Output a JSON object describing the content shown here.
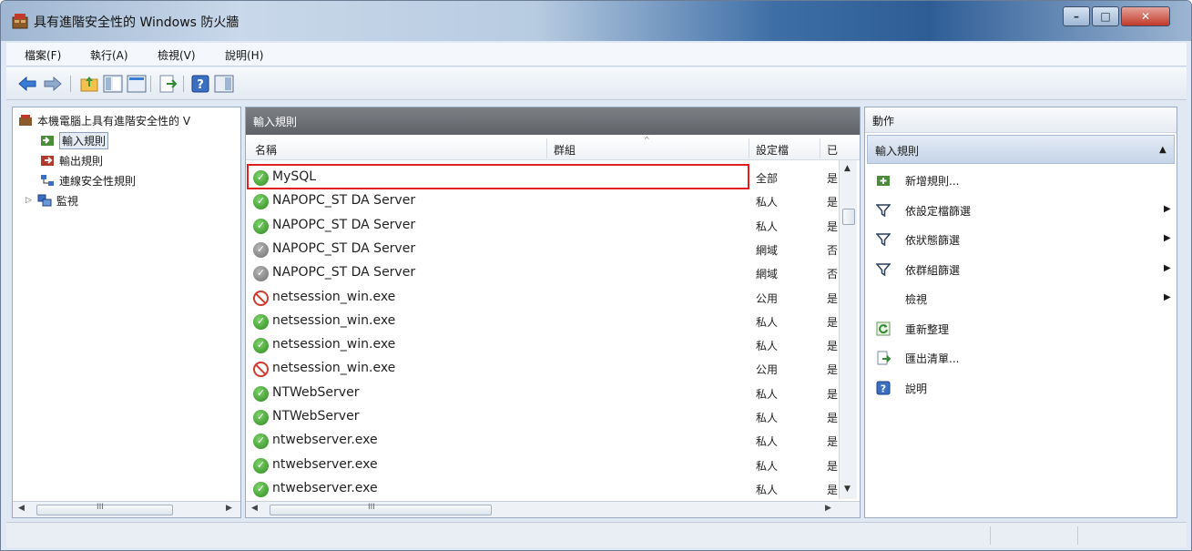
{
  "window": {
    "title": "具有進階安全性的 Windows 防火牆"
  },
  "menu": [
    {
      "label": "檔案(F)"
    },
    {
      "label": "執行(A)"
    },
    {
      "label": "檢視(V)"
    },
    {
      "label": "說明(H)"
    }
  ],
  "toolbar": {
    "icons": [
      "back-icon",
      "forward-icon",
      "up-folder-icon",
      "show-hide-tree-icon",
      "export-icon",
      "help-icon",
      "show-action-pane-icon"
    ]
  },
  "tree": {
    "root": "本機電腦上具有進階安全性的 V",
    "items": [
      {
        "label": "輸入規則",
        "selected": true
      },
      {
        "label": "輸出規則"
      },
      {
        "label": "連線安全性規則"
      },
      {
        "label": "監視"
      }
    ]
  },
  "center": {
    "header": "輸入規則",
    "columns": {
      "name": "名稱",
      "group": "群組",
      "profile": "設定檔",
      "enabled": "已"
    },
    "rules": [
      {
        "name": "MySQL",
        "state": "ok",
        "profile": "全部",
        "enabled": "是"
      },
      {
        "name": "NAPOPC_ST DA Server",
        "state": "ok",
        "profile": "私人",
        "enabled": "是"
      },
      {
        "name": "NAPOPC_ST DA Server",
        "state": "ok",
        "profile": "私人",
        "enabled": "是"
      },
      {
        "name": "NAPOPC_ST DA Server",
        "state": "off",
        "profile": "網域",
        "enabled": "否"
      },
      {
        "name": "NAPOPC_ST DA Server",
        "state": "off",
        "profile": "網域",
        "enabled": "否"
      },
      {
        "name": "netsession_win.exe",
        "state": "block",
        "profile": "公用",
        "enabled": "是"
      },
      {
        "name": "netsession_win.exe",
        "state": "ok",
        "profile": "私人",
        "enabled": "是"
      },
      {
        "name": "netsession_win.exe",
        "state": "ok",
        "profile": "私人",
        "enabled": "是"
      },
      {
        "name": "netsession_win.exe",
        "state": "block",
        "profile": "公用",
        "enabled": "是"
      },
      {
        "name": "NTWebServer",
        "state": "ok",
        "profile": "私人",
        "enabled": "是"
      },
      {
        "name": "NTWebServer",
        "state": "ok",
        "profile": "私人",
        "enabled": "是"
      },
      {
        "name": "ntwebserver.exe",
        "state": "ok",
        "profile": "私人",
        "enabled": "是"
      },
      {
        "name": "ntwebserver.exe",
        "state": "ok",
        "profile": "私人",
        "enabled": "是"
      },
      {
        "name": "ntwebserver.exe",
        "state": "ok",
        "profile": "私人",
        "enabled": "是"
      }
    ]
  },
  "actions": {
    "header": "動作",
    "section": "輸入規則",
    "items": [
      {
        "label": "新增規則...",
        "icon": "new-rule-icon",
        "submenu": false
      },
      {
        "label": "依設定檔篩選",
        "icon": "filter-icon",
        "submenu": true
      },
      {
        "label": "依狀態篩選",
        "icon": "filter-icon",
        "submenu": true
      },
      {
        "label": "依群組篩選",
        "icon": "filter-icon",
        "submenu": true
      },
      {
        "label": "檢視",
        "icon": "",
        "submenu": true
      },
      {
        "label": "重新整理",
        "icon": "refresh-icon",
        "submenu": false
      },
      {
        "label": "匯出清單...",
        "icon": "export-list-icon",
        "submenu": false
      },
      {
        "label": "說明",
        "icon": "help-icon",
        "submenu": false
      }
    ]
  },
  "scrollbar": {
    "grip": "III"
  },
  "colors": {
    "highlight": "#e02020",
    "pane_header": "#6b6e73",
    "enabled_green": "#2d8a1e",
    "block_red": "#d13b2f"
  }
}
